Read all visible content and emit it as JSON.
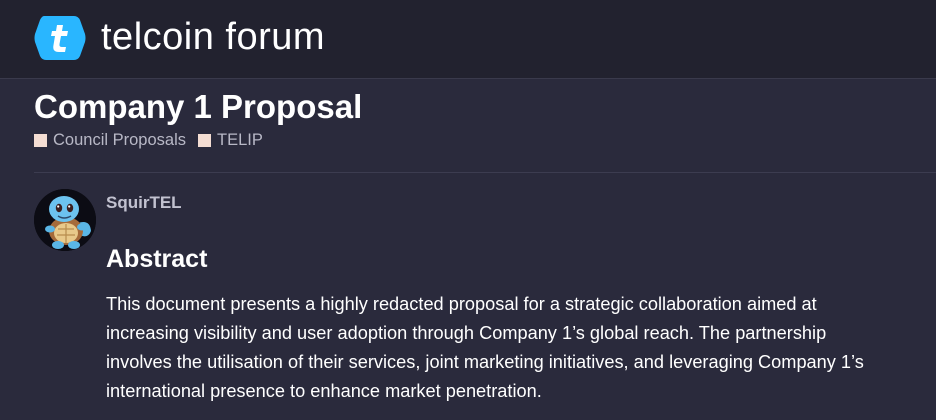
{
  "header": {
    "logo_icon": "telcoin-logo-icon",
    "site_name": "telcoin forum",
    "brand_color": "#29b6ff"
  },
  "topic": {
    "title": "Company 1 Proposal",
    "categories": [
      {
        "label": "Council Proposals",
        "color": "#f4ddd3"
      },
      {
        "label": "TELIP",
        "color": "#f4ddd3"
      }
    ]
  },
  "post": {
    "author": "SquirTEL",
    "avatar_icon": "squirtle-avatar-icon",
    "heading": "Abstract",
    "body_lines": [
      "This document presents a highly redacted proposal for a strategic collaboration aimed at",
      "increasing visibility and user adoption through Company 1’s global reach. The partnership",
      "involves the utilisation of their services, joint marketing initiatives, and leveraging Company 1’s",
      "international presence to enhance market penetration."
    ]
  }
}
